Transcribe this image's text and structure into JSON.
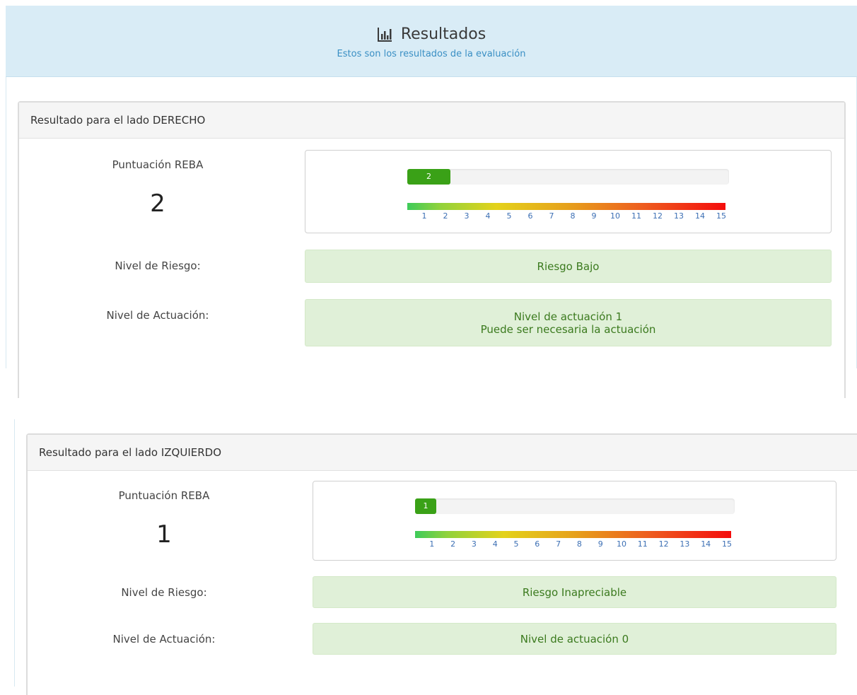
{
  "header": {
    "title": "Resultados",
    "subtitle": "Estos son los resultados de la evaluación",
    "icon": "bar-chart-icon"
  },
  "labels": {
    "score": "Puntuación REBA",
    "risk": "Nivel de Riesgo:",
    "action": "Nivel de Actuación:"
  },
  "scale_ticks": [
    "1",
    "2",
    "3",
    "4",
    "5",
    "6",
    "7",
    "8",
    "9",
    "10",
    "11",
    "12",
    "13",
    "14",
    "15"
  ],
  "scale_max": 15,
  "right": {
    "heading": "Resultado para el lado DERECHO",
    "score": "2",
    "score_fraction": 0.133,
    "risk": "Riesgo Bajo",
    "action_line1": "Nivel de actuación 1",
    "action_line2": "Puede ser necesaria la actuación"
  },
  "left": {
    "heading": "Resultado para el lado IZQUIERDO",
    "score": "1",
    "score_fraction": 0.067,
    "risk": "Riesgo Inapreciable",
    "action_line1": "Nivel de actuación 0"
  },
  "colors": {
    "header_bg": "#d9ecf6",
    "subtitle": "#3a8fc4",
    "bar_fill": "#3aa117",
    "alert_bg": "#e0f0d8",
    "alert_text": "#3b7a1e"
  }
}
